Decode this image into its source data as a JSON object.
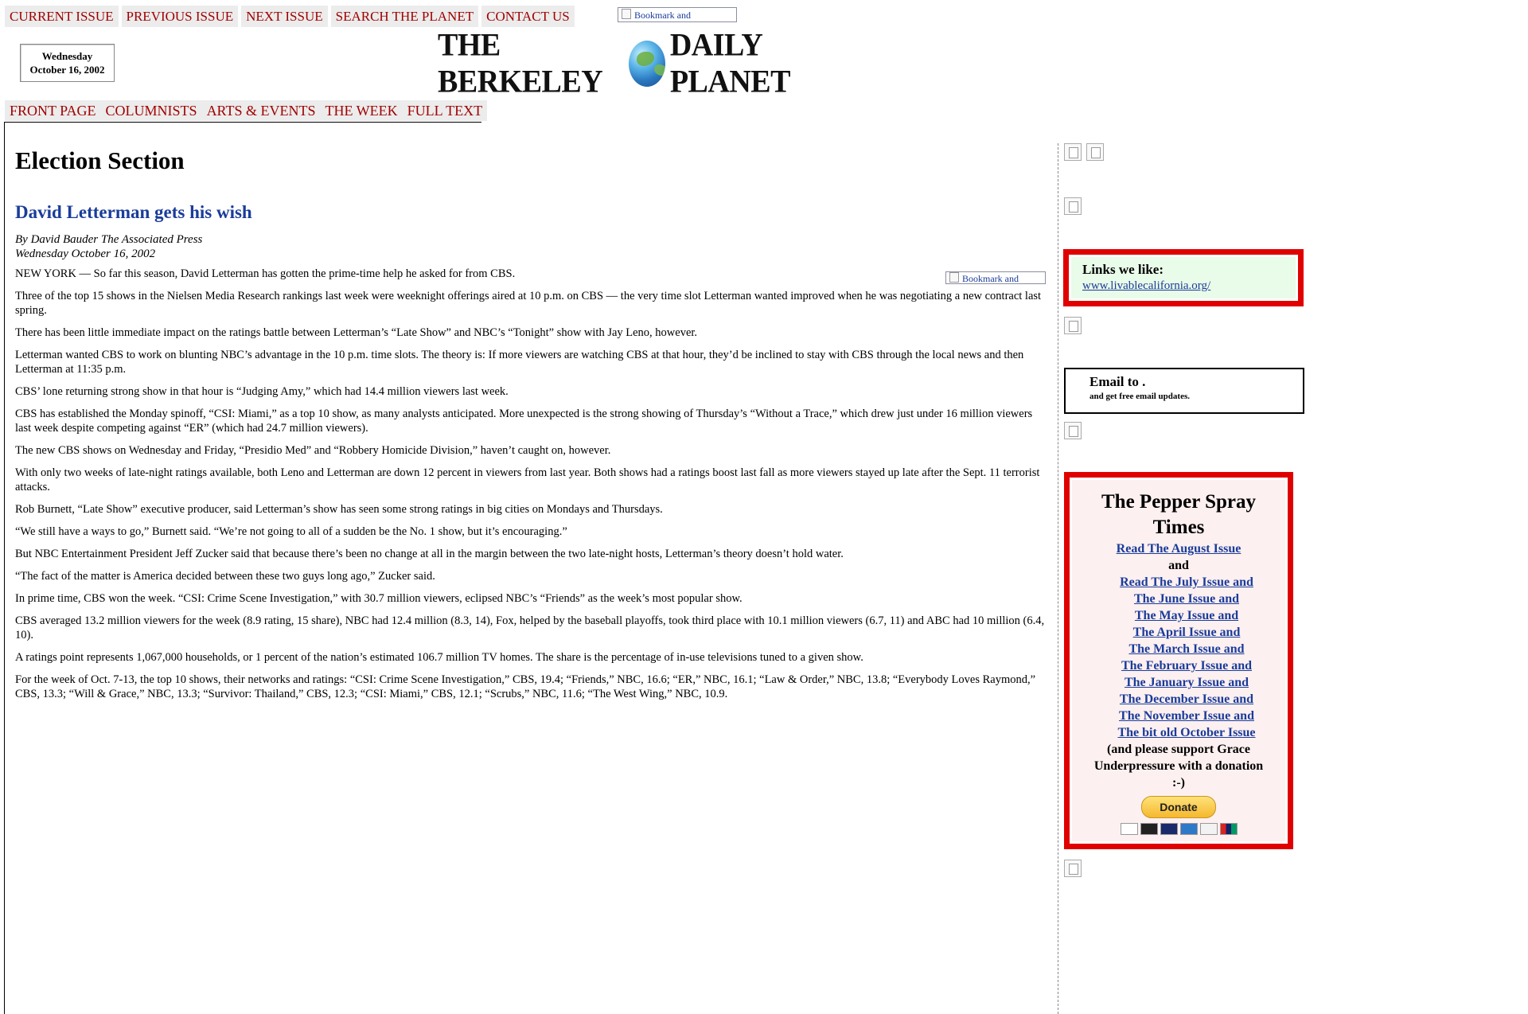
{
  "top_nav": {
    "items": [
      "CURRENT ISSUE",
      "PREVIOUS ISSUE",
      "NEXT ISSUE",
      "SEARCH THE PLANET",
      "CONTACT US"
    ],
    "bookmark_label": "Bookmark and"
  },
  "date": {
    "weekday": "Wednesday",
    "full": "October 16, 2002"
  },
  "masthead": {
    "left": "THE BERKELEY",
    "right": "DAILY PLANET",
    "globe_icon": "globe-icon"
  },
  "section_nav": {
    "items": [
      "FRONT PAGE",
      "COLUMNISTS",
      "ARTS & EVENTS",
      "THE WEEK",
      "FULL TEXT"
    ]
  },
  "article": {
    "section_title": "Election Section",
    "headline": "David Letterman gets his wish",
    "byline": "By David Bauder The Associated Press",
    "dateline": "Wednesday October 16, 2002",
    "bookmark_label": "Bookmark and",
    "paragraphs": [
      "NEW YORK — So far this season, David Letterman has gotten the prime-time help he asked for from CBS.",
      "Three of the top 15 shows in the Nielsen Media Research rankings last week were weeknight offerings aired at 10 p.m. on CBS — the very time slot Letterman wanted improved when he was negotiating a new contract last spring.",
      "There has been little immediate impact on the ratings battle between Letterman’s “Late Show” and NBC’s “Tonight” show with Jay Leno, however.",
      "Letterman wanted CBS to work on blunting NBC’s advantage in the 10 p.m. time slots. The theory is: If more viewers are watching CBS at that hour, they’d be inclined to stay with CBS through the local news and then Letterman at 11:35 p.m.",
      "CBS’ lone returning strong show in that hour is “Judging Amy,” which had 14.4 million viewers last week.",
      "CBS has established the Monday spinoff, “CSI: Miami,” as a top 10 show, as many analysts anticipated. More unexpected is the strong showing of Thursday’s “Without a Trace,” which drew just under 16 million viewers last week despite competing against “ER” (which had 24.7 million viewers).",
      "The new CBS shows on Wednesday and Friday, “Presidio Med” and “Robbery Homicide Division,” haven’t caught on, however.",
      "With only two weeks of late-night ratings available, both Leno and Letterman are down 12 percent in viewers from last year. Both shows had a ratings boost last fall as more viewers stayed up late after the Sept. 11 terrorist attacks.",
      "Rob Burnett, “Late Show” executive producer, said Letterman’s show has seen some strong ratings in big cities on Mondays and Thursdays.",
      "“We still have a ways to go,” Burnett said. “We’re not going to all of a sudden be the No. 1 show, but it’s encouraging.”",
      "But NBC Entertainment President Jeff Zucker said that because there’s been no change at all in the margin between the two late-night hosts, Letterman’s theory doesn’t hold water.",
      "“The fact of the matter is America decided between these two guys long ago,” Zucker said.",
      "In prime time, CBS won the week. “CSI: Crime Scene Investigation,” with 30.7 million viewers, eclipsed NBC’s “Friends” as the week’s most popular show.",
      "CBS averaged 13.2 million viewers for the week (8.9 rating, 15 share), NBC had 12.4 million (8.3, 14), Fox, helped by the baseball playoffs, took third place with 10.1 million viewers (6.7, 11) and ABC had 10 million (6.4, 10).",
      "A ratings point represents 1,067,000 households, or 1 percent of the nation’s estimated 106.7 million TV homes. The share is the percentage of in-use televisions tuned to a given show.",
      "For the week of Oct. 7-13, the top 10 shows, their networks and ratings: “CSI: Crime Scene Investigation,” CBS, 19.4; “Friends,” NBC, 16.6; “ER,” NBC, 16.1; “Law & Order,” NBC, 13.8; “Everybody Loves Raymond,” CBS, 13.3; “Will & Grace,” NBC, 13.3; “Survivor: Thailand,” CBS, 12.3; “CSI: Miami,” CBS, 12.1; “Scrubs,” NBC, 11.6; “The West Wing,” NBC, 10.9."
    ]
  },
  "sidebar": {
    "links_box": {
      "title": "Links we like:",
      "url_text": "www.livablecalifornia.org/"
    },
    "email_box": {
      "title": "Email to .",
      "subtitle": "and get free email updates."
    },
    "pepper_box": {
      "title": "The Pepper Spray Times",
      "first_link": "Read The August Issue",
      "and_text": "and",
      "links": [
        "Read The July Issue and",
        "The June Issue and",
        "The May Issue and",
        "The April Issue and",
        "The March Issue and",
        "The February Issue and",
        "The January Issue and",
        "The December Issue and",
        "The November Issue and",
        "The bit old October Issue"
      ],
      "note": "(and please support Grace Underpressure with a donation :-)",
      "donate_label": "Donate",
      "card_icons": [
        "visa-icon",
        "mastercard-icon",
        "maestro-icon",
        "amex-icon",
        "discover-icon",
        "unionpay-icon"
      ]
    },
    "broken_image_icon": "broken-image-icon"
  },
  "colors": {
    "nav_text": "#a00000",
    "nav_bg": "#ececec",
    "headline": "#1a3c9a",
    "box_border": "#e00000",
    "links_bg": "#e9fbe9",
    "pepper_bg": "#fdf0f0"
  }
}
